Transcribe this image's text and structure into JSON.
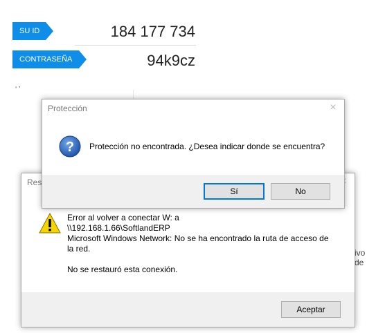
{
  "session": {
    "id_label": "SU ID",
    "id_value": "184 177 734",
    "password_label": "CONTRASEÑA",
    "password_value": "94k9cz",
    "partial_text_right": "ivo de",
    "partial_text_left": "‘ ’"
  },
  "error_dialog": {
    "title": "Rest",
    "message_lines": [
      "Error al volver a conectar W: a",
      "\\\\192.168.1.66\\SoftlandERP",
      "Microsoft Windows Network: No se ha encontrado la ruta de acceso de",
      "la red."
    ],
    "message_footer": "No se restauró esta conexión.",
    "accept_label": "Aceptar",
    "close_icon": "×"
  },
  "protection_dialog": {
    "title": "Protección",
    "message": "Protección no encontrada. ¿Desea indicar donde se encuentra?",
    "yes_label": "Sí",
    "no_label": "No",
    "close_icon": "×"
  },
  "colors": {
    "accent": "#0e8ee9",
    "question_icon": "#1f5fb8",
    "warning_icon": "#f5d400"
  }
}
